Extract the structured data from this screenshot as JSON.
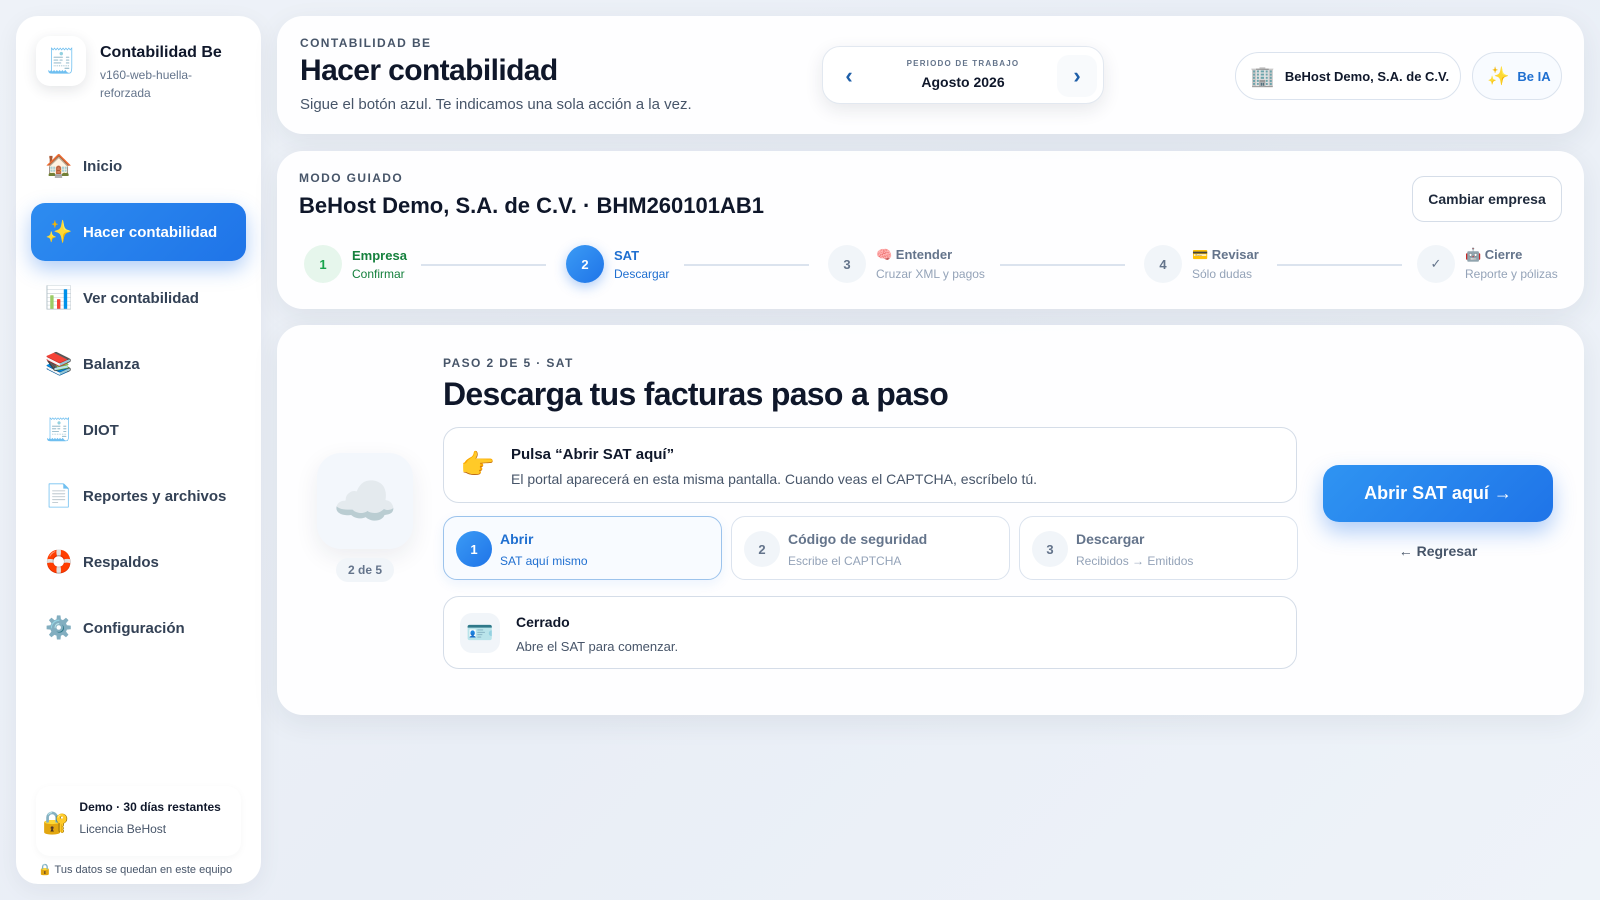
{
  "brand": {
    "name": "Contabilidad Be",
    "version": "v160-web-huella-reforzada",
    "logo_icon": "accounting-logo-icon"
  },
  "sidebar": {
    "items": [
      {
        "label": "Inicio",
        "icon": "🏠",
        "icon_name": "home-icon"
      },
      {
        "label": "Hacer contabilidad",
        "icon": "✨",
        "icon_name": "sparkles-icon"
      },
      {
        "label": "Ver contabilidad",
        "icon": "📊",
        "icon_name": "bar-chart-icon"
      },
      {
        "label": "Balanza",
        "icon": "📚",
        "icon_name": "books-icon"
      },
      {
        "label": "DIOT",
        "icon": "🧾",
        "icon_name": "receipt-icon"
      },
      {
        "label": "Reportes y archivos",
        "icon": "📄",
        "icon_name": "document-icon"
      },
      {
        "label": "Respaldos",
        "icon": "🛟",
        "icon_name": "lifebuoy-icon"
      },
      {
        "label": "Configuración",
        "icon": "⚙️",
        "icon_name": "gear-icon"
      }
    ],
    "active_index": 1,
    "license": {
      "icon": "🔐",
      "title": "Demo · 30 días restantes",
      "subtitle": "Licencia BeHost"
    },
    "privacy_note": "🔒 Tus datos se quedan en este equipo"
  },
  "header": {
    "eyebrow": "CONTABILIDAD BE",
    "title": "Hacer contabilidad",
    "subtitle": "Sigue el botón azul. Te indicamos una sola acción a la vez.",
    "period": {
      "label": "PERIODO DE TRABAJO",
      "value": "Agosto 2026",
      "prev_symbol": "‹",
      "next_symbol": "›"
    },
    "company_pill": {
      "icon": "🏢",
      "label": "BeHost Demo, S.A. de C.V."
    },
    "ia_pill": {
      "icon": "✨",
      "label": "Be IA"
    }
  },
  "guided": {
    "eyebrow": "MODO GUIADO",
    "company": "BeHost Demo, S.A. de C.V. · BHM260101AB1",
    "change_button": "Cambiar empresa",
    "steps": [
      {
        "num": "1",
        "label": "Empresa",
        "sub": "Confirmar",
        "state": "done"
      },
      {
        "num": "2",
        "label": "SAT",
        "sub": "Descargar",
        "state": "current"
      },
      {
        "num": "3",
        "label": "🧠 Entender",
        "sub": "Cruzar XML y pagos",
        "state": "pending"
      },
      {
        "num": "4",
        "label": "💳 Revisar",
        "sub": "Sólo dudas",
        "state": "pending"
      },
      {
        "num": "✓",
        "label": "🤖 Cierre",
        "sub": "Reporte y pólizas",
        "state": "pending"
      }
    ]
  },
  "main": {
    "cloud_icon": "☁️",
    "progress_badge": "2 de 5",
    "eyebrow": "PASO 2 DE 5 · SAT",
    "title": "Descarga tus facturas paso a paso",
    "hint": {
      "icon": "👉",
      "title": "Pulsa “Abrir SAT aquí”",
      "text": "El portal aparecerá en esta misma pantalla. Cuando veas el CAPTCHA, escríbelo tú."
    },
    "sub_steps": [
      {
        "num": "1",
        "title": "Abrir",
        "sub": "SAT aquí mismo",
        "active": true
      },
      {
        "num": "2",
        "title": "Código de seguridad",
        "sub": "Escribe el CAPTCHA",
        "active": false
      },
      {
        "num": "3",
        "title": "Descargar",
        "sub": "Recibidos → Emitidos",
        "active": false
      }
    ],
    "status": {
      "icon": "🪪",
      "title": "Cerrado",
      "text": "Abre el SAT para comenzar."
    },
    "primary_button": "Abrir SAT aquí →",
    "back_link": "← Regresar"
  },
  "colors": {
    "accent": "#1f74e8",
    "success": "#16a34a",
    "text": "#0f172a",
    "muted": "#64748b"
  }
}
